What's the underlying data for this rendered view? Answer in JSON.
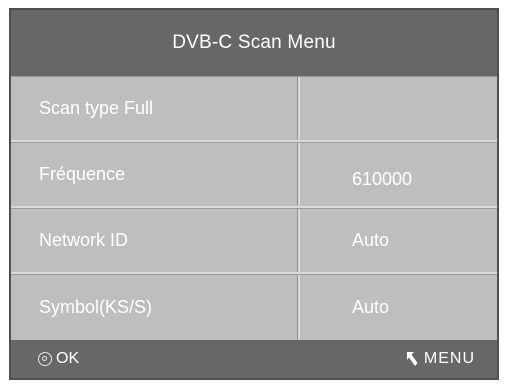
{
  "menu": {
    "title": "DVB-C Scan Menu",
    "rows": [
      {
        "label": "Scan type Full",
        "value": ""
      },
      {
        "label": "Fréquence",
        "value": "610000"
      },
      {
        "label": "Network ID",
        "value": "Auto"
      },
      {
        "label": "Symbol(KS/S)",
        "value": "Auto"
      }
    ]
  },
  "footer": {
    "ok_label": "OK",
    "ok_icon": "ok-circle-icon",
    "menu_label": "MENU",
    "menu_icon": "return-arrow-icon"
  },
  "colors": {
    "bar": "#676767",
    "rows": "#bebebe",
    "text": "#ffffff"
  }
}
